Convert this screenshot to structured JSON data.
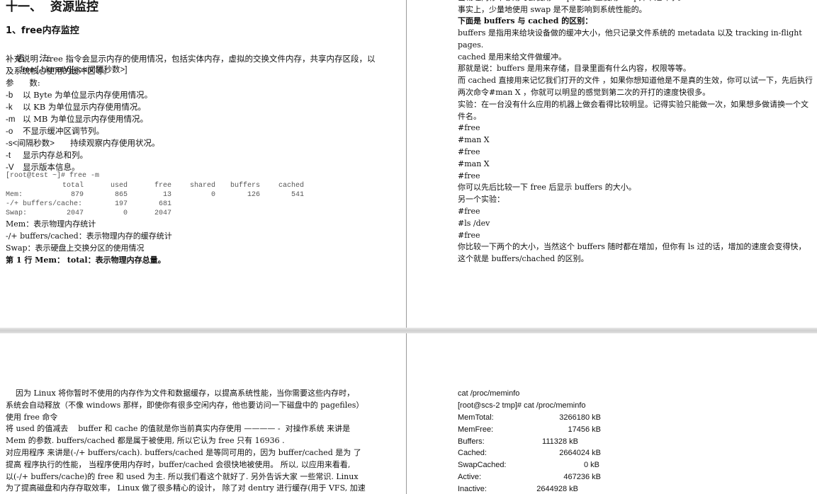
{
  "page1": {
    "title": "十一、  资源监控",
    "section": "1、free内存监控",
    "syntax_label": "语      法:",
    "syntax_value": "free [-bkmotV][-s <间隔秒数>]",
    "note_line1": "补充说明：free 指令会显示内存的使用情况，包括实体内存，虚拟的交换文件内存，共享内存区段，以",
    "note_line2": "及系统核心使用的缓冲区等。",
    "params_label": "参      数:",
    "options": [
      {
        "flag": "-b",
        "desc": "以 Byte 为单位显示内存使用情况。"
      },
      {
        "flag": "-k",
        "desc": "以 KB 为单位显示内存使用情况。"
      },
      {
        "flag": "-m",
        "desc": "以 MB 为单位显示内存使用情况。"
      },
      {
        "flag": "-o",
        "desc": "不显示缓冲区调节列。"
      },
      {
        "flag": "-s<间隔秒数>",
        "desc": "持续观察内存使用状况。"
      },
      {
        "flag": "-t",
        "desc": "显示内存总和列。"
      },
      {
        "flag": "-V",
        "desc": "显示版本信息。"
      }
    ],
    "terminal": {
      "prompt": "[root@test ~]# free -m",
      "headers": [
        "",
        "total",
        "used",
        "free",
        "shared",
        "buffers",
        "cached"
      ],
      "rows": [
        [
          "Mem:",
          "879",
          "865",
          "13",
          "0",
          "126",
          "541"
        ],
        [
          "-/+ buffers/cache:",
          "",
          "197",
          "681",
          "",
          "",
          ""
        ],
        [
          "Swap:",
          "2047",
          "0",
          "2047",
          "",
          "",
          ""
        ]
      ]
    },
    "explain": [
      "Mem：表示物理内存统计",
      "-/+ buffers/cached：表示物理内存的缓存统计",
      "Swap：表示硬盘上交换分区的使用情况"
    ],
    "bold_line": "第 1 行 Mem： total：表示物理内存总量。"
  },
  "page2": {
    "cut_line": "当物理内存不够用时会使用swap，但少量使用swap并不是坏事。",
    "lines": [
      "事实上，少量地使用 swap 是不是影响到系统性能的。"
    ],
    "bold_heading": "下面是 buffers 与 cached 的区别：",
    "body": [
      "buffers 是指用来给块设备做的缓冲大小，他只记录文件系统的 metadata 以及 tracking in-flight",
      "pages.",
      "cached 是用来给文件做缓冲。",
      "那就是说：buffers 是用来存储，目录里面有什么内容，权限等等。",
      "而 cached 直接用来记忆我们打开的文件 ，如果你想知道他是不是真的生效，你可以试一下，先后执行",
      "两次命令#man X ，你就可以明显的感觉到第二次的开打的速度快很多。",
      "实验：在一台没有什么应用的机器上做会看得比较明显。记得实验只能做一次，如果想多做请换一个文",
      "件名。",
      "#free",
      "#man X",
      "#free",
      "#man X",
      "#free",
      "你可以先后比较一下 free 后显示 buffers 的大小。",
      "另一个实验：",
      "#free",
      "#ls /dev",
      "#free",
      "你比较一下两个的大小，当然这个 buffers 随时都在增加，但你有 ls 过的话，增加的速度会变得快，",
      "这个就是 buffers/chached 的区别。"
    ]
  },
  "page3": {
    "lines": [
      "    因为 Linux 将你暂时不使用的内存作为文件和数据缓存，以提高系统性能，当你需要这些内存时，",
      "系统会自动释放（不像 windows 那样，即使你有很多空闲内存，他也要访问一下磁盘中的 pagefiles）",
      "使用 free 命令",
      "将 used 的值减去    buffer 和 cache 的值就是你当前真实内存使用 ———— -  对操作系统 来讲是",
      "Mem 的参数. buffers/cached 都是属于被使用, 所以它认为 free 只有 16936 .",
      "对应用程序 来讲是(-/+ buffers/cach). buffers/cached 是等同可用的，因为 buffer/cached 是为 了",
      "提高 程序执行的性能， 当程序使用内存时，buffer/cached 会很快地被使用。 所以, 以应用来看看,",
      "以(-/+ buffers/cache)的 free 和 used 为主. 所以我们看这个就好了. 另外告诉大家 一些常识. Linux",
      "为了提高磁盘和内存存取效率， Linux 做了很多精心的设计， 除了对 dentry 进行缓存(用于 VFS, 加速"
    ]
  },
  "page4": {
    "cmd": "cat /proc/meminfo",
    "prompt": "[root@scs-2 tmp]# cat /proc/meminfo",
    "meminfo": [
      {
        "key": "MemTotal:",
        "value": "3266180 kB"
      },
      {
        "key": "MemFree:",
        "value": "17456 kB"
      },
      {
        "key": "Buffers:",
        "value": "111328 kB"
      },
      {
        "key": "Cached:",
        "value": "2664024 kB"
      },
      {
        "key": "SwapCached:",
        "value": "0 kB"
      },
      {
        "key": "Active:",
        "value": "467236 kB"
      },
      {
        "key": "Inactive:",
        "value": "2644928 kB"
      }
    ]
  }
}
